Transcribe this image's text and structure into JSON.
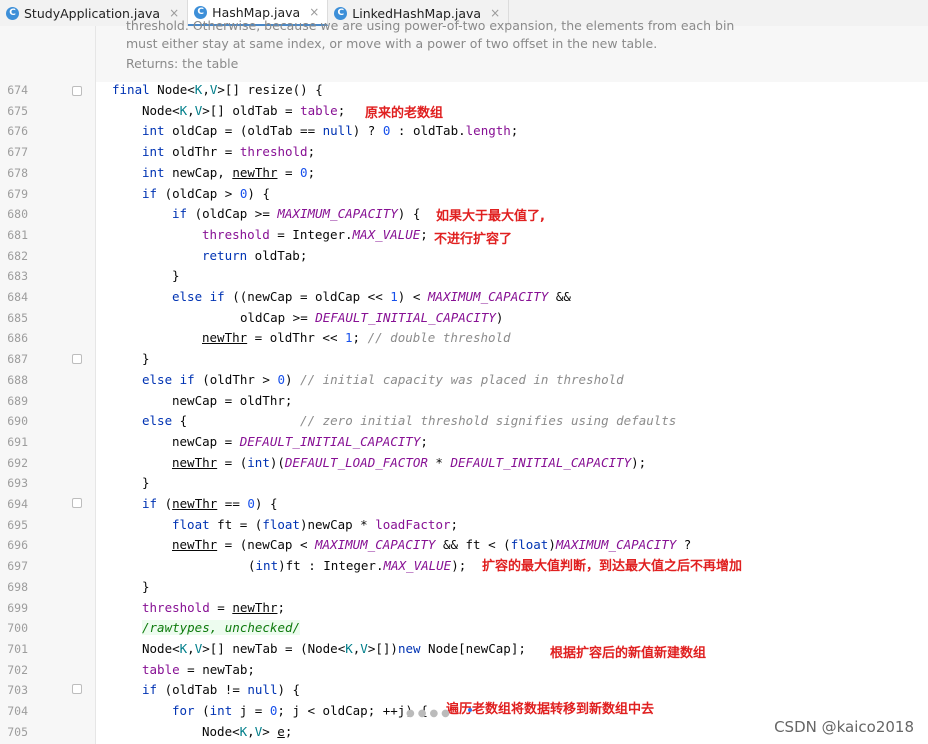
{
  "tabs": [
    {
      "label": "StudyApplication.java",
      "icon": "C",
      "close": "×",
      "active": false
    },
    {
      "label": "HashMap.java",
      "icon": "C",
      "close": "×",
      "active": true
    },
    {
      "label": "LinkedHashMap.java",
      "icon": "C",
      "close": "×",
      "active": false
    }
  ],
  "doc": {
    "line1": "threshold. Otherwise, because we are using power-of-two expansion, the elements from each bin",
    "line2": "must either stay at same index, or move with a power of two offset in the new table.",
    "returns": "Returns: the table"
  },
  "line_numbers": [
    "674",
    "675",
    "676",
    "677",
    "678",
    "679",
    "680",
    "681",
    "682",
    "683",
    "684",
    "685",
    "686",
    "687",
    "688",
    "689",
    "690",
    "691",
    "692",
    "693",
    "694",
    "695",
    "696",
    "697",
    "698",
    "699",
    "700",
    "701",
    "702",
    "703",
    "704",
    "705"
  ],
  "notes": {
    "n675": "原来的老数组",
    "n680": "如果大于最大值了,",
    "n681": "不进行扩容了",
    "n697": "扩容的最大值判断，到达最大值之后不再增加",
    "n701": "根据扩容后的新值新建数组",
    "n704": "遍历老数组将数据转移到新数组中去"
  },
  "watermark": "CSDN @kaico2018",
  "colors": {
    "keyword": "#0033b3",
    "field": "#871094",
    "number": "#1750eb",
    "comment": "#8c8c8c",
    "type_param": "#007e8a",
    "annotation": "#0e7a0d",
    "note_red": "#e02020",
    "active_tab_underline": "#4a88c7"
  }
}
